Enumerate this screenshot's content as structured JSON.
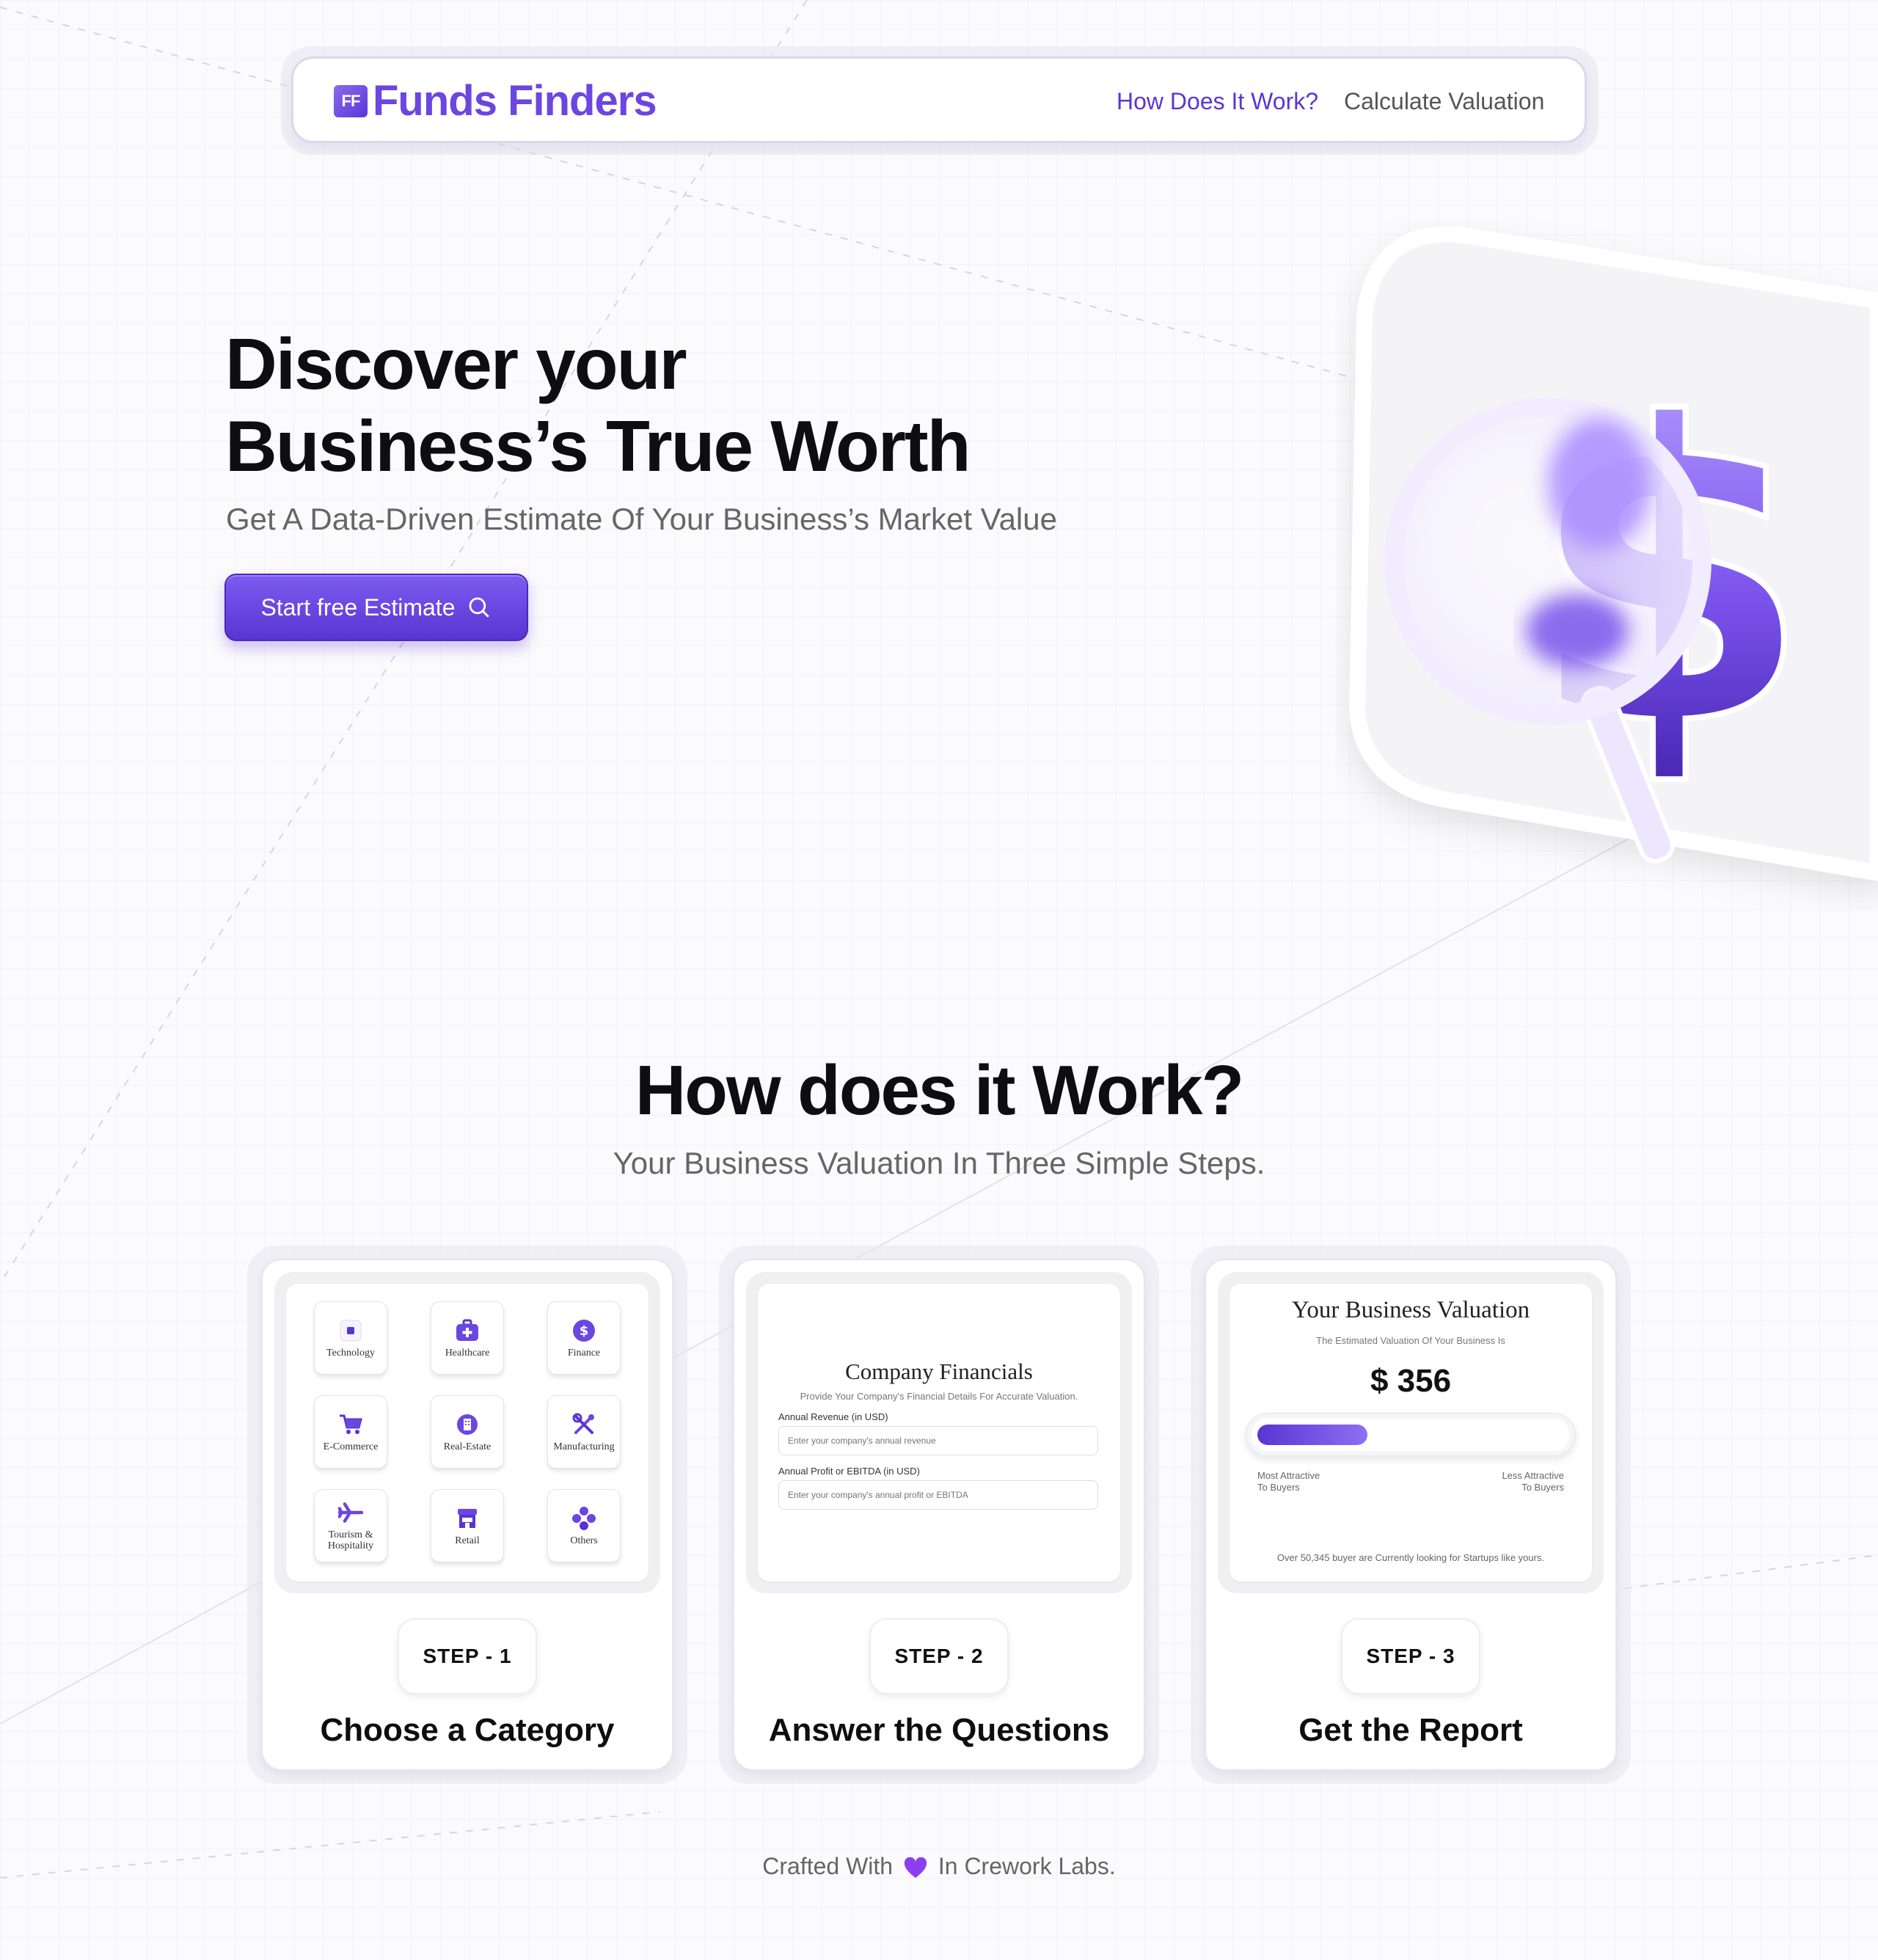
{
  "nav": {
    "logo_mark": "FF",
    "logo_text": "Funds Finders",
    "links": [
      {
        "label": "How Does It Work?",
        "active": true
      },
      {
        "label": "Calculate Valuation",
        "active": false
      }
    ]
  },
  "hero": {
    "title_line1": "Discover your",
    "title_line2": "Business’s True Worth",
    "subtitle": "Get A Data-Driven Estimate Of Your Business’s Market Value",
    "cta_label": "Start free Estimate",
    "cta_icon": "search-icon"
  },
  "how": {
    "title": "How does it Work?",
    "subtitle": "Your Business Valuation In Three Simple Steps."
  },
  "steps": [
    {
      "step_label": "STEP - 1",
      "title": "Choose a Category",
      "categories": [
        {
          "label": "Technology",
          "icon": "chip-icon"
        },
        {
          "label": "Healthcare",
          "icon": "medical-kit-icon"
        },
        {
          "label": "Finance",
          "icon": "dollar-coin-icon"
        },
        {
          "label": "E-Commerce",
          "icon": "cart-icon"
        },
        {
          "label": "Real-Estate",
          "icon": "building-icon"
        },
        {
          "label": "Manufacturing",
          "icon": "tools-icon"
        },
        {
          "label": "Tourism &\nHospitality",
          "icon": "airplane-icon"
        },
        {
          "label": "Retail",
          "icon": "store-icon"
        },
        {
          "label": "Others",
          "icon": "dots-cluster-icon"
        }
      ]
    },
    {
      "step_label": "STEP - 2",
      "title": "Answer the Questions",
      "form": {
        "title": "Company Financials",
        "description": "Provide Your Company's Financial Details For Accurate Valuation.",
        "revenue_label": "Annual Revenue (in USD)",
        "revenue_placeholder": "Enter your company's annual revenue",
        "profit_label": "Annual Profit or EBITDA (in USD)",
        "profit_placeholder": "Enter your company's annual profit or EBITDA"
      }
    },
    {
      "step_label": "STEP - 3",
      "title": "Get the Report",
      "report": {
        "title": "Your Business Valuation",
        "description": "The Estimated Valuation Of Your Business Is",
        "value": "$ 356",
        "bar_level": 0.36,
        "left_label": "Most Attractive\nTo Buyers",
        "right_label": "Less Attractive\nTo Buyers",
        "footnote": "Over 50,345 buyer are Currently looking for Startups like yours."
      }
    }
  ],
  "footer": {
    "before": "Crafted With",
    "icon": "purple-heart-icon",
    "after": "In Crework Labs."
  },
  "colors": {
    "brand": "#6b46e0",
    "brand_dark": "#5a34d2",
    "text": "#0d0d12",
    "muted": "#666666"
  }
}
